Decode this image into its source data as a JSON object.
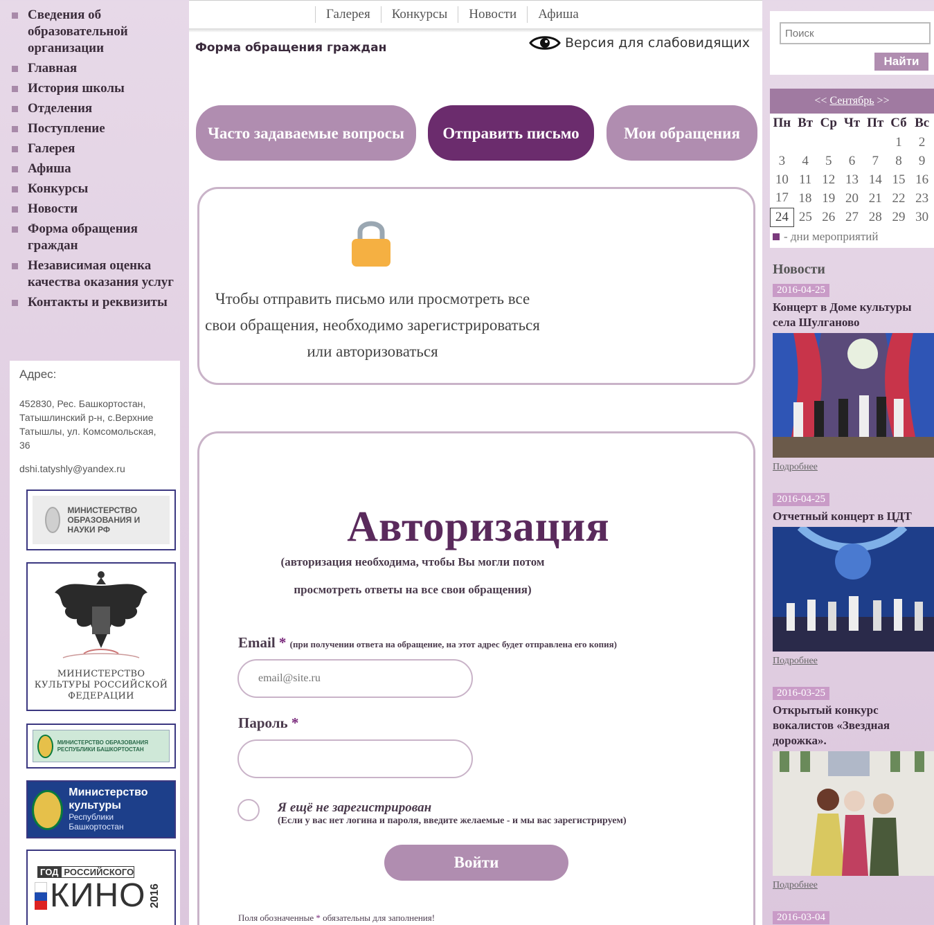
{
  "side_nav": [
    "Сведения об образовательной организации",
    "Главная",
    "История школы",
    "Отделения",
    "Поступление",
    "Галерея",
    "Афиша",
    "Конкурсы",
    "Новости",
    "Форма обращения граждан",
    "Независимая оценка качества оказания услуг",
    "Контакты и реквизиты"
  ],
  "address": {
    "title": "Адрес:",
    "text": "452830, Рес. Башкортостан, Татышлинский р-н, с.Верхние Татышлы, ул. Комсомольская, 36",
    "email": "dshi.tatyshly@yandex.ru"
  },
  "banners": {
    "minobr": "МИНИСТЕРСТВО ОБРАЗОВАНИЯ И НАУКИ РФ",
    "minkult": "МИНИСТЕРСТВО КУЛЬТУРЫ РОССИЙСКОЙ ФЕДЕРАЦИИ",
    "minobr_rb": "МИНИСТЕРСТВО ОБРАЗОВАНИЯ РЕСПУБЛИКИ БАШКОРТОСТАН",
    "minkult_rb_title": "Министерство культуры",
    "minkult_rb_sub": "Республики Башкортостан",
    "kino_god": "ГОД",
    "kino_rk": "РОССИЙСКОГО",
    "kino_word": "КИНО",
    "kino_year": "2016"
  },
  "top_nav": [
    "Галерея",
    "Конкурсы",
    "Новости",
    "Афиша"
  ],
  "page_title": "Форма обращения граждан",
  "low_vision": "Версия для слабовидящих",
  "tabs": {
    "faq": "Часто задаваемые вопросы",
    "send": "Отправить письмо",
    "mine": "Мои обращения"
  },
  "lock_message": "Чтобы отправить письмо или просмотреть все свои обращения, необходимо зарегистрироваться или авторизоваться",
  "auth": {
    "title": "Авторизация",
    "subtitle": "(авторизация необходима, чтобы Вы могли потом просмотреть ответы на все свои обращения)",
    "email_label": "Email",
    "email_hint": "(при получении ответа на обращение, на этот адрес будет отправлена его копия)",
    "email_placeholder": "email@site.ru",
    "password_label": "Пароль",
    "required_mark": "*",
    "not_registered": "Я ещё не зарегистрирован",
    "not_registered_hint": "(Если у вас нет логина и пароля, введите желаемые - и мы вас зарегистрируем)",
    "login_button": "Войти",
    "required_note_before": "Поля обозначенные",
    "required_note_after": "обязательны для заполнения!"
  },
  "search": {
    "placeholder": "Поиск",
    "button": "Найти"
  },
  "calendar": {
    "prev": "<<",
    "month": "Сентябрь",
    "next": ">>",
    "weekdays": [
      "Пн",
      "Вт",
      "Ср",
      "Чт",
      "Пт",
      "Сб",
      "Вс"
    ],
    "weeks": [
      [
        "",
        "",
        "",
        "",
        "",
        "1",
        "2"
      ],
      [
        "3",
        "4",
        "5",
        "6",
        "7",
        "8",
        "9"
      ],
      [
        "10",
        "11",
        "12",
        "13",
        "14",
        "15",
        "16"
      ],
      [
        "17",
        "18",
        "19",
        "20",
        "21",
        "22",
        "23"
      ],
      [
        "24",
        "25",
        "26",
        "27",
        "28",
        "29",
        "30"
      ]
    ],
    "today": "24",
    "legend": "- дни мероприятий"
  },
  "news": {
    "heading": "Новости",
    "more": "Подробнее",
    "items": [
      {
        "date": "2016-04-25",
        "title": "Концерт в Доме культуры села Шулганово"
      },
      {
        "date": "2016-04-25",
        "title": "Отчетный концерт в ЦДТ"
      },
      {
        "date": "2016-03-25",
        "title": "Открытый конкурс вокалистов «Звездная дорожка»."
      },
      {
        "date": "2016-03-04",
        "title": ""
      }
    ]
  },
  "colors": {
    "accent_dark": "#6b2c6d",
    "accent_light": "#b08db0",
    "border": "#c9b3c8",
    "lock": "#f5b042"
  }
}
